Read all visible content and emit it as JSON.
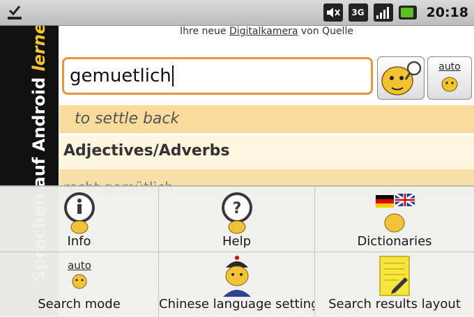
{
  "status_bar": {
    "time": "20:18",
    "icons": [
      "download-done-icon",
      "mute-icon",
      "3g-icon",
      "signal-icon",
      "battery-icon"
    ],
    "network_label": "3G"
  },
  "banner": {
    "text_part1": "Sprachen auf ",
    "text_part2": "Android",
    "text_part3": " lernen."
  },
  "ad": {
    "prefix": "Ihre neue ",
    "link": "Digitalkamera",
    "suffix": " von Quelle"
  },
  "search": {
    "value": "gemuetlich",
    "auto_label": "auto"
  },
  "results": {
    "translation": "to settle back",
    "section_heading": "Adjectives/Adverbs",
    "entry_partial": "recht gemütlich"
  },
  "menu": {
    "items": [
      {
        "label": "Info",
        "icon": "info-icon"
      },
      {
        "label": "Help",
        "icon": "help-icon"
      },
      {
        "label": "Dictionaries",
        "icon": "dictionaries-icon"
      },
      {
        "label": "Search mode",
        "icon": "search-mode-icon",
        "icon_text": "auto"
      },
      {
        "label": "Chinese language setting",
        "icon": "chinese-setting-icon"
      },
      {
        "label": "Search results layout",
        "icon": "results-layout-icon"
      }
    ]
  },
  "colors": {
    "accent_orange": "#e5963a",
    "result_band": "#f9dc9b",
    "leo_yellow": "#f2c230"
  }
}
